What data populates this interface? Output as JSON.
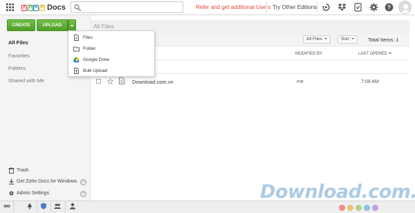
{
  "colors": {
    "accent_green": "#5aa832",
    "refer_red": "#e2453c",
    "sidebar_bg": "#f4f4f4"
  },
  "topbar": {
    "apps_icon": "apps-grid-icon",
    "logo": {
      "letters": [
        "Z",
        "O",
        "H",
        "O"
      ],
      "product": "Docs"
    },
    "search": {
      "icon": "search-icon",
      "placeholder": "",
      "value": ""
    },
    "refer_link": "Refer and get additional Users",
    "editions_link": "Try Other Editions",
    "icons": [
      "sync-icon",
      "dropbox-icon",
      "checklist-icon",
      "gear-icon",
      "help-icon",
      "avatar"
    ]
  },
  "sidebar": {
    "create_label": "CREATE",
    "upload_label": "UPLOAD",
    "nav": [
      {
        "label": "All Files",
        "active": true
      },
      {
        "label": "Favorites",
        "active": false
      },
      {
        "label": "Folders",
        "active": false
      },
      {
        "label": "Shared with Me",
        "active": false
      }
    ],
    "footer": [
      {
        "label": "Trash",
        "icon": "trash-icon",
        "help": false
      },
      {
        "label": "Get Zoho Docs for Windows",
        "icon": "download-icon",
        "help": true
      },
      {
        "label": "Admin Settings",
        "icon": "gear-icon",
        "help": true
      }
    ]
  },
  "upload_menu": {
    "items": [
      {
        "label": "Files",
        "icon": "file-icon"
      },
      {
        "label": "Folder",
        "icon": "folder-icon"
      },
      {
        "label": "Google Drive",
        "icon": "google-drive-icon"
      },
      {
        "label": "Bulk Upload",
        "icon": "bulk-upload-icon"
      }
    ]
  },
  "content": {
    "title": "All Files",
    "filter_label": "All Files",
    "sort_label": "Sort",
    "total_items": "Total Items: 1",
    "columns": {
      "modified_by": "MODIFIED BY",
      "last_opened": "LAST OPENED"
    },
    "files": [
      {
        "name": "Download.com.vn",
        "modified_by": "me",
        "last_opened": "7:09 AM",
        "starred": false
      }
    ]
  },
  "bottombar": {
    "icons": [
      "infinity-icon",
      "tree-icon",
      "shield-icon",
      "people-icon",
      "person-icon"
    ]
  },
  "watermark": {
    "text": "Download.com.vn",
    "dot_colors": [
      "#e94b3c",
      "#f3a12c",
      "#8bc34a",
      "#4aa3df",
      "#9575cd"
    ]
  }
}
